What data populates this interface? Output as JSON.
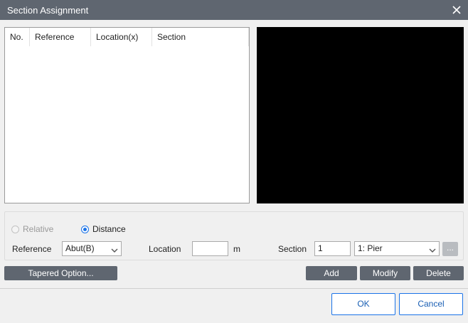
{
  "window": {
    "title": "Section Assignment"
  },
  "list": {
    "columns": [
      "No.",
      "Reference",
      "Location(x)",
      "Section"
    ],
    "rows": []
  },
  "mode": {
    "relative_label": "Relative",
    "distance_label": "Distance",
    "selected": "Distance"
  },
  "form": {
    "reference_label": "Reference",
    "reference_value": "Abut(B)",
    "location_label": "Location",
    "location_value": "",
    "location_unit": "m",
    "section_label": "Section",
    "section_number": "1",
    "section_value": "1: Pier",
    "browse_label": "..."
  },
  "buttons": {
    "tapered": "Tapered Option...",
    "add": "Add",
    "modify": "Modify",
    "delete": "Delete",
    "ok": "OK",
    "cancel": "Cancel"
  },
  "colors": {
    "titlebar": "#5f6670",
    "button": "#5f6670",
    "accent": "#1a73e8",
    "preview_bg": "#000000"
  }
}
